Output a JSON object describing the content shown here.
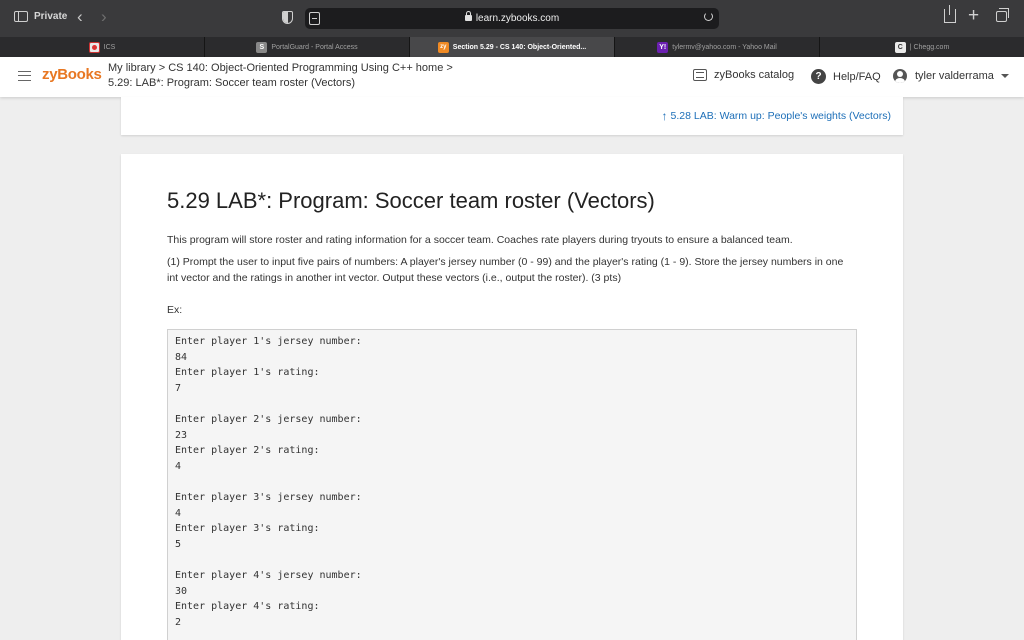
{
  "browser": {
    "private_label": "Private",
    "url": "learn.zybooks.com",
    "tabs": [
      {
        "label": "ICS",
        "favicon": "ics-icon"
      },
      {
        "label": "PortalGuard - Portal Access",
        "favicon": "S"
      },
      {
        "label": "Section 5.29 - CS 140: Object-Oriented...",
        "favicon": "zy",
        "active": true
      },
      {
        "label": "tylermv@yahoo.com - Yahoo Mail",
        "favicon": "Y!"
      },
      {
        "label": "| Chegg.com",
        "favicon": "C"
      }
    ]
  },
  "header": {
    "logo": "zyBooks",
    "breadcrumb_line1": "My library > CS 140: Object-Oriented Programming Using C++ home >",
    "breadcrumb_line2": "5.29: LAB*: Program: Soccer team roster (Vectors)",
    "catalog": "zyBooks catalog",
    "help": "Help/FAQ",
    "help_icon_glyph": "?",
    "user": "tyler valderrama"
  },
  "prev_section": {
    "arrow": "↑",
    "label": "5.28 LAB: Warm up: People's weights (Vectors)"
  },
  "section": {
    "title": "5.29 LAB*: Program: Soccer team roster (Vectors)",
    "intro": "This program will store roster and rating information for a soccer team. Coaches rate players during tryouts to ensure a balanced team.",
    "step1": "(1) Prompt the user to input five pairs of numbers: A player's jersey number (0 - 99) and the player's rating (1 - 9). Store the jersey numbers in one int vector and the ratings in another int vector. Output these vectors (i.e., output the roster). (3 pts)",
    "ex_label": "Ex:",
    "example_lines": [
      "Enter player 1's jersey number:",
      "84",
      "Enter player 1's rating:",
      "7",
      "",
      "Enter player 2's jersey number:",
      "23",
      "Enter player 2's rating:",
      "4",
      "",
      "Enter player 3's jersey number:",
      "4",
      "Enter player 3's rating:",
      "5",
      "",
      "Enter player 4's jersey number:",
      "30",
      "Enter player 4's rating:",
      "2"
    ]
  }
}
